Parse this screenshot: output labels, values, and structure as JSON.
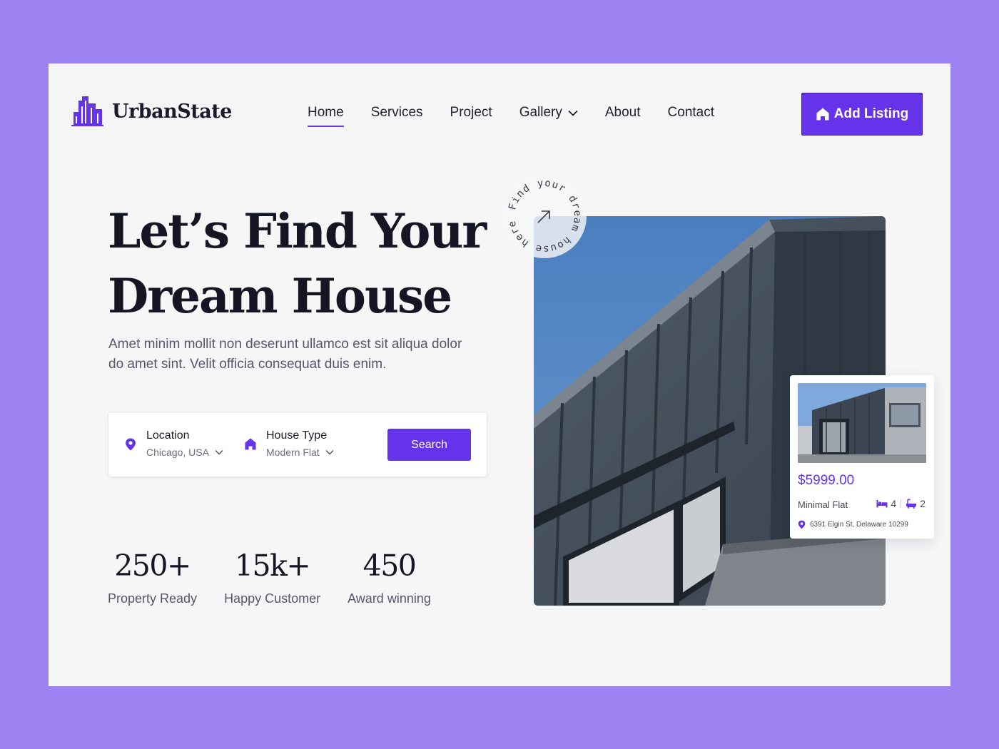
{
  "brand": {
    "name": "UrbanState",
    "accent": "#6533ea",
    "background": "#9d82f2"
  },
  "nav": {
    "items": [
      {
        "label": "Home",
        "active": true
      },
      {
        "label": "Services"
      },
      {
        "label": "Project"
      },
      {
        "label": "Gallery",
        "has_dropdown": true
      },
      {
        "label": "About"
      },
      {
        "label": "Contact"
      }
    ],
    "cta_label": "Add Listing"
  },
  "hero": {
    "title_line1": "Let’s Find Your",
    "title_line2": "Dream House",
    "subtitle": "Amet minim mollit non deserunt ullamco est sit aliqua dolor do amet sint. Velit officia consequat duis enim."
  },
  "search": {
    "location": {
      "label": "Location",
      "value": "Chicago, USA",
      "icon": "location-pin-icon"
    },
    "house_type": {
      "label": "House Type",
      "value": "Modern Flat",
      "icon": "house-icon"
    },
    "button_label": "Search"
  },
  "stats": [
    {
      "value": "250+",
      "label": "Property Ready"
    },
    {
      "value": "15k+",
      "label": "Happy Customer"
    },
    {
      "value": "450",
      "label": "Award winning"
    }
  ],
  "badge": {
    "text": "Find your dream house here",
    "icon": "arrow-up-right-icon"
  },
  "listing": {
    "price": "$5999.00",
    "name": "Minimal Flat",
    "beds": "4",
    "baths": "2",
    "address": "6391 Elgin St, Delaware 10299"
  }
}
